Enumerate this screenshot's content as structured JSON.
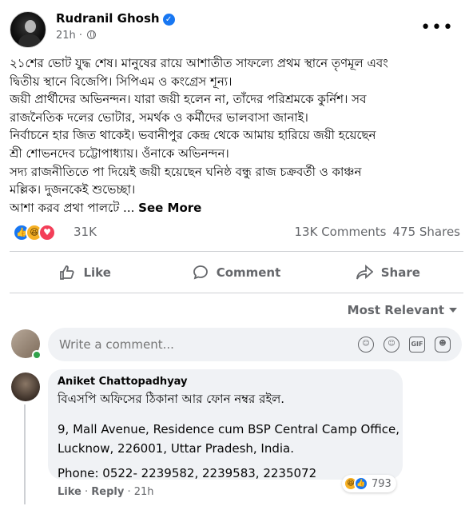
{
  "post": {
    "author": "Rudranil Ghosh",
    "verified": true,
    "time": "21h",
    "lines": [
      "২১শের ভোট যুদ্ধ শেষ। মানুষের রায়ে আশাতীত সাফল্যে প্রথম স্থানে তৃণমূল এবং",
      "দ্বিতীয় স্থানে বিজেপি। সিপিএম ও কংগ্রেস শূন্য।",
      "জয়ী প্রার্থীদের অভিনন্দন। যারা জয়ী হলেন না, তাঁদের পরিশ্রমকে কুর্নিশ। সব",
      "রাজনৈতিক দলের ভোটার, সমর্থক ও কর্মীদের ভালবাসা জানাই।",
      "নির্বাচনে হার জিত থাকেই। ভবানীপুর কেন্দ্র থেকে আমায় হারিয়ে জয়ী হয়েছেন",
      "শ্রী শোভনদেব চট্টোপাধ্যায়। ওঁনাকে অভিনন্দন।",
      "সদ্য রাজনীতিতে পা দিয়েই জয়ী হয়েছেন ঘনিষ্ঠ বন্ধু রাজ চক্রবর্তী ও কাঞ্চন",
      "মল্লিক। দুজনকেই শুভেচ্ছা।"
    ],
    "last_line": "আশা করব প্রথা পালটে ...",
    "see_more": "See More"
  },
  "stats": {
    "reactions": "31K",
    "comments": "13K Comments",
    "shares": "475 Shares"
  },
  "actions": {
    "like": "Like",
    "comment": "Comment",
    "share": "Share"
  },
  "sort": {
    "label": "Most Relevant"
  },
  "composer": {
    "placeholder": "Write a comment..."
  },
  "comment": {
    "author": "Aniket Chattopadhyay",
    "line1": "বিএসপি অফিসের ঠিকানা আর ফোন নম্বর রইল.",
    "address1": "9, Mall Avenue, Residence cum BSP Central Camp Office,",
    "address2": "Lucknow, 226001, Uttar Pradesh, India.",
    "phone": "Phone: 0522- 2239582, 2239583, 2235072",
    "like": "Like",
    "reply": "Reply",
    "time": "21h",
    "reaction_count": "793"
  },
  "colors": {
    "brand": "#1877f2",
    "muted": "#65676b",
    "bubble": "#f0f2f5"
  }
}
